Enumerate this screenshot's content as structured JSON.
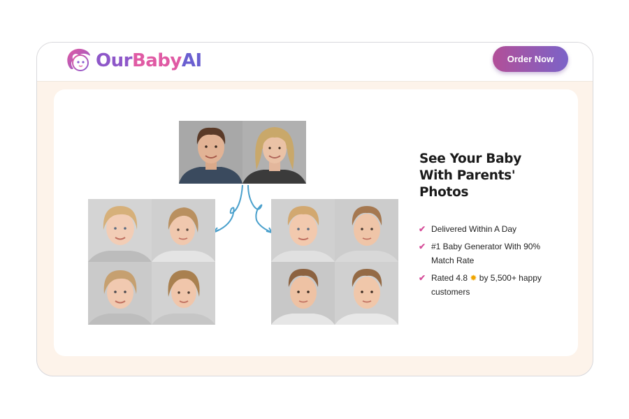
{
  "brand": {
    "part1": "Our",
    "part2": "Baby",
    "part3": "AI",
    "accent": "#e05aa4",
    "accent2": "#7b63c8"
  },
  "nav": {
    "order_label": "Order Now"
  },
  "hero": {
    "heading": "See Your Baby With Parents' Photos",
    "features": [
      {
        "icon": "check-icon",
        "text": "Delivered Within A Day"
      },
      {
        "icon": "check-icon",
        "text": "#1 Baby Generator With 90% Match Rate"
      },
      {
        "icon": "check-icon",
        "text_before": "Rated 4.8",
        "star": "✹",
        "text_after": "by 5,500+ happy customers"
      }
    ]
  },
  "images": {
    "parents": [
      "father-photo",
      "mother-photo"
    ],
    "girl_children": 4,
    "boy_children": 4
  }
}
